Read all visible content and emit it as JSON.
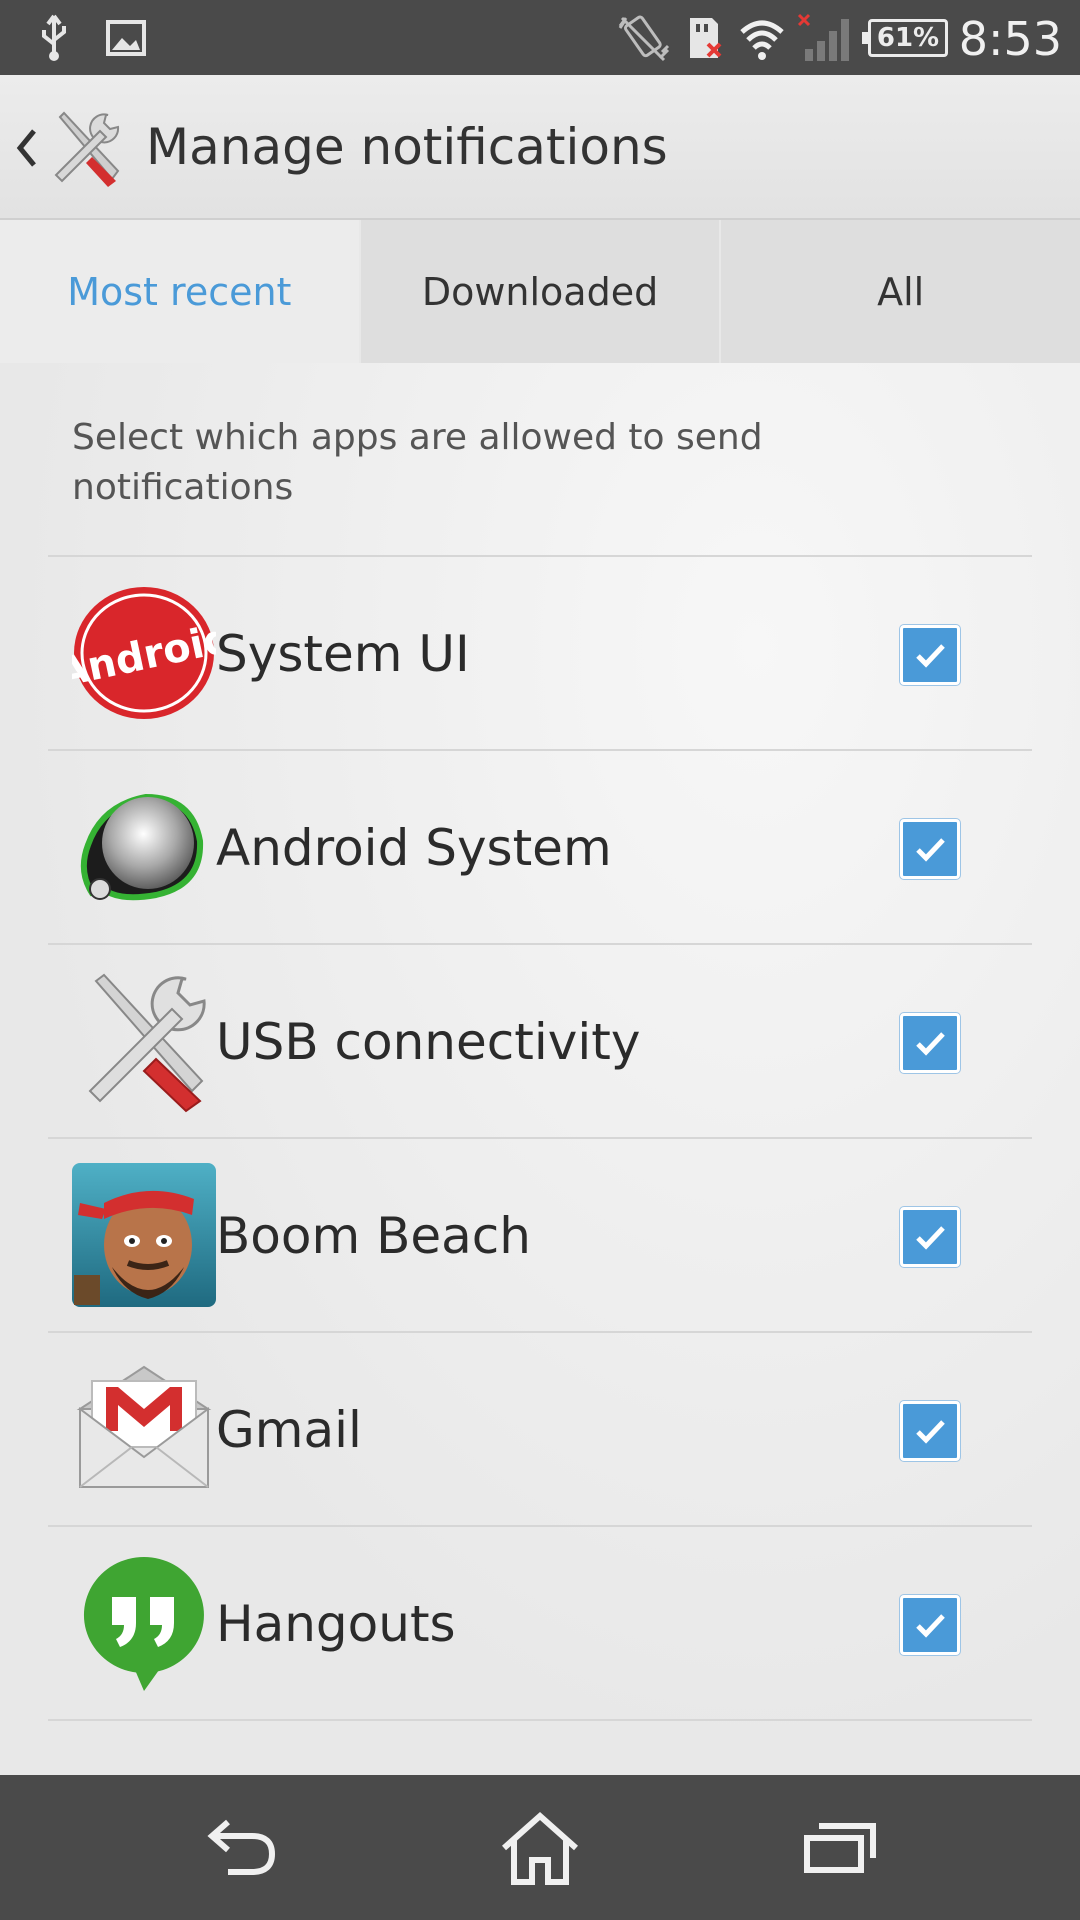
{
  "status_bar": {
    "time": "8:53",
    "battery": "61%",
    "icons": [
      "usb-icon",
      "image-icon",
      "vibrate-icon",
      "sd-card-error-icon",
      "wifi-icon",
      "no-signal-icon",
      "battery-icon"
    ]
  },
  "header": {
    "title": "Manage notifications",
    "icon": "tools-icon"
  },
  "tabs": [
    {
      "label": "Most recent",
      "active": true
    },
    {
      "label": "Downloaded",
      "active": false
    },
    {
      "label": "All",
      "active": false
    }
  ],
  "description": "Select which apps are allowed to send notifications",
  "apps": [
    {
      "name": "System UI",
      "icon": "android-kitkat-icon",
      "checked": true
    },
    {
      "name": "Android System",
      "icon": "android-system-icon",
      "checked": true
    },
    {
      "name": "USB connectivity",
      "icon": "tools-icon",
      "checked": true
    },
    {
      "name": "Boom Beach",
      "icon": "boom-beach-icon",
      "checked": true
    },
    {
      "name": "Gmail",
      "icon": "gmail-icon",
      "checked": true
    },
    {
      "name": "Hangouts",
      "icon": "hangouts-icon",
      "checked": true
    }
  ],
  "nav_bar": {
    "buttons": [
      "back-icon",
      "home-icon",
      "recents-icon"
    ]
  },
  "colors": {
    "accent": "#4a9ad8",
    "status_bar": "#4a4a4a",
    "nav_bar": "#4a4a4a"
  }
}
